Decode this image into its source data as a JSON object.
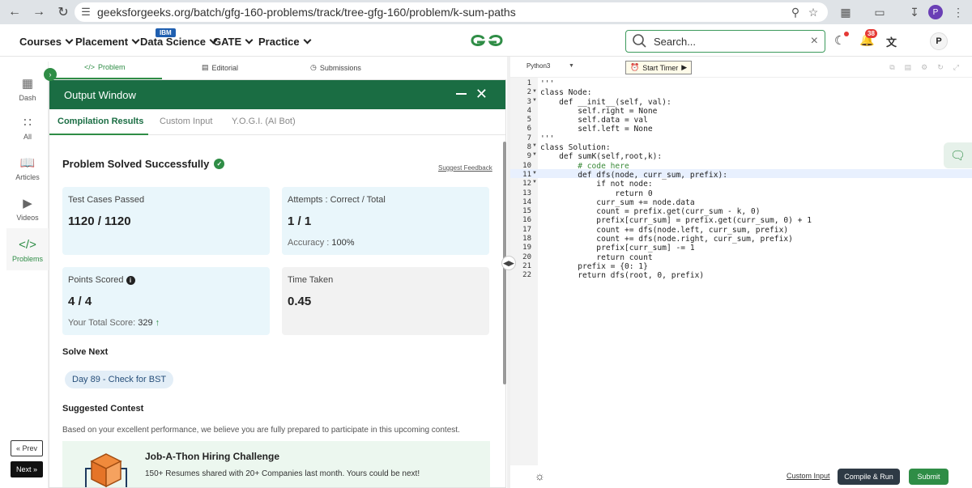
{
  "browser": {
    "url": "geeksforgeeks.org/batch/gfg-160-problems/track/tree-gfg-160/problem/k-sum-paths",
    "profile_initial": "P"
  },
  "nav": {
    "items": [
      "Courses",
      "Placement",
      "Data Science",
      "GATE",
      "Practice"
    ],
    "ibm_badge": "IBM",
    "search_placeholder": "Search...",
    "notification_count": "38",
    "avatar_initial": "P"
  },
  "sidebar": {
    "items": [
      "Dash",
      "All",
      "Articles",
      "Videos",
      "Problems"
    ],
    "prev_label": "Prev",
    "next_label": "Next"
  },
  "problem_tabs": [
    "Problem",
    "Editorial",
    "Submissions"
  ],
  "output": {
    "title": "Output Window",
    "tabs": [
      "Compilation Results",
      "Custom Input",
      "Y.O.G.I. (AI Bot)"
    ],
    "status": "Problem Solved Successfully",
    "feedback_link": "Suggest Feedback",
    "cards": {
      "test_cases_label": "Test Cases Passed",
      "test_cases_value": "1120 / 1120",
      "attempts_label": "Attempts : Correct / Total",
      "attempts_value": "1 / 1",
      "accuracy_label": "Accuracy :",
      "accuracy_value": "100%",
      "points_label": "Points Scored",
      "points_value": "4 / 4",
      "total_score_label": "Your Total Score:",
      "total_score_value": "329",
      "time_label": "Time Taken",
      "time_value": "0.45"
    },
    "solve_next_title": "Solve Next",
    "solve_next_chip": "Day 89 - Check for BST",
    "contest_title": "Suggested Contest",
    "contest_desc": "Based on your excellent performance, we believe you are fully prepared to participate in this upcoming contest.",
    "contest_name": "Job-A-Thon Hiring Challenge",
    "contest_sub": "150+ Resumes shared with 20+ Companies last month. Yours could be next!"
  },
  "editor": {
    "language": "Python3",
    "timer_label": "Start Timer",
    "footer": {
      "custom_input": "Custom Input",
      "compile_run": "Compile & Run",
      "submit": "Submit"
    },
    "lines": [
      "'''",
      "class Node:",
      "    def __init__(self, val):",
      "        self.right = None",
      "        self.data = val",
      "        self.left = None",
      "'''",
      "class Solution:",
      "    def sumK(self,root,k):",
      "        # code here",
      "        def dfs(node, curr_sum, prefix):",
      "            if not node:",
      "                return 0",
      "            curr_sum += node.data",
      "            count = prefix.get(curr_sum - k, 0)",
      "            prefix[curr_sum] = prefix.get(curr_sum, 0) + 1",
      "            count += dfs(node.left, curr_sum, prefix)",
      "            count += dfs(node.right, curr_sum, prefix)",
      "            prefix[curr_sum] -= 1",
      "            return count",
      "        prefix = {0: 1}",
      "        return dfs(root, 0, prefix)"
    ],
    "line_numbers": [
      "1",
      "2",
      "3",
      "4",
      "5",
      "6",
      "7",
      "8",
      "9",
      "10",
      "11",
      "12",
      "13",
      "14",
      "15",
      "16",
      "17",
      "18",
      "19",
      "20",
      "21",
      "22"
    ]
  }
}
